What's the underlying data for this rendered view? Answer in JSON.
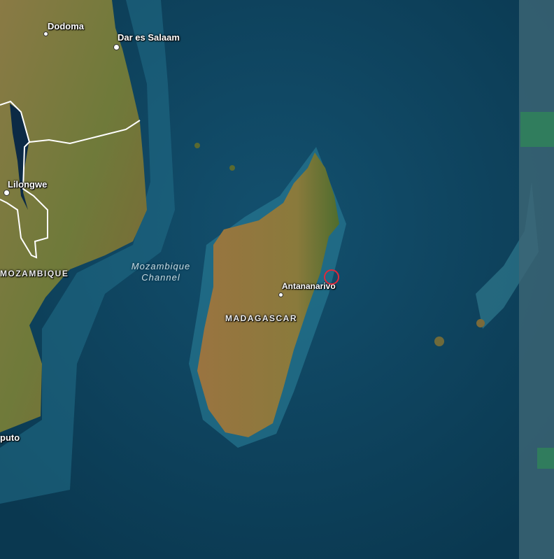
{
  "map": {
    "basemap": "satellite-imagery",
    "cities": [
      {
        "name": "Dodoma"
      },
      {
        "name": "Dar es Salaam"
      },
      {
        "name": "Lilongwe"
      },
      {
        "name": "Antananarivo"
      },
      {
        "name": "puto"
      }
    ],
    "countries": [
      "MOZAMBIQUE",
      "MADAGASCAR"
    ],
    "water_bodies": [
      {
        "line1": "Mozambique",
        "line2": "Channel"
      }
    ],
    "marker": {
      "type": "circle",
      "color": "#e0283a"
    },
    "colors": {
      "ocean": "#0d3f5a",
      "shallow": "#2a7a90",
      "land": "#7a6a3a",
      "border": "#ffffff"
    }
  }
}
